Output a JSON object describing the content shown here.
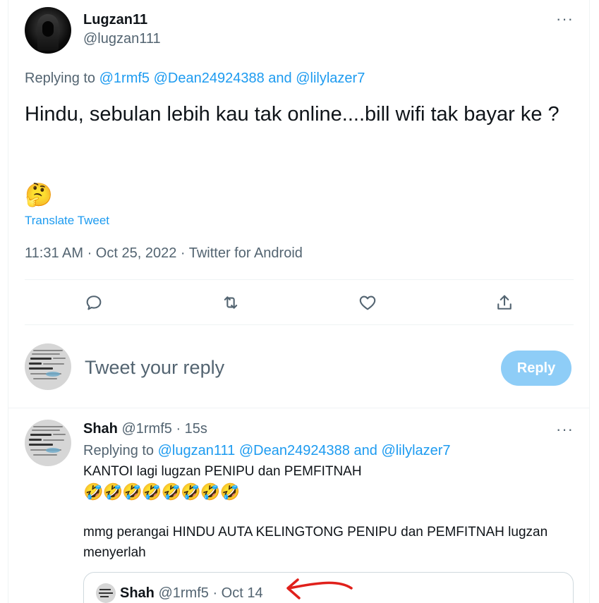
{
  "tweet": {
    "author_name": "Lugzan11",
    "author_handle": "@lugzan111",
    "more_icon": "···",
    "replying_prefix": "Replying to",
    "mention1": "@1rmf5",
    "mention2": "@Dean24924388",
    "and_word": "and",
    "mention3": "@lilylazer7",
    "text": "Hindu, sebulan lebih kau tak online....bill wifi tak bayar ke ?",
    "emoji": "🤔",
    "translate_label": "Translate Tweet",
    "meta": "11:31 AM · Oct 25, 2022 · Twitter for Android"
  },
  "actions": {
    "icons": [
      "reply-icon",
      "retweet-icon",
      "like-icon",
      "share-icon"
    ]
  },
  "compose": {
    "placeholder": "Tweet your reply",
    "button_label": "Reply",
    "button_color": "#8ecdf7"
  },
  "reply": {
    "author_name": "Shah",
    "author_handle": "@1rmf5",
    "time": "· 15s",
    "more_icon": "···",
    "replying_prefix": "Replying to",
    "mention1": "@lugzan111",
    "mention2": "@Dean24924388",
    "and_word": "and",
    "mention3": "@lilylazer7",
    "line1": "KANTOI lagi lugzan PENIPU dan PEMFITNAH",
    "emojis": "🤣🤣🤣🤣🤣🤣🤣🤣",
    "line2": "mmg perangai HINDU AUTA KELINGTONG PENIPU dan PEMFITNAH lugzan menyerlah"
  },
  "quote": {
    "author_name": "Shah",
    "author_handle": "@1rmf5",
    "date": "· Oct 14"
  },
  "colors": {
    "accent": "#1d9bf0",
    "secondary_text": "#536471",
    "annotation_arrow": "#e0201b"
  }
}
